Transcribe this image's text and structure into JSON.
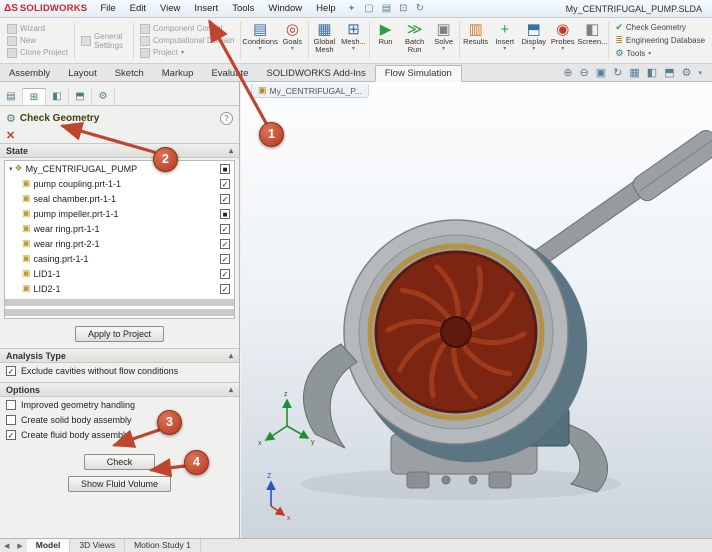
{
  "titlebar": {
    "logo_text": "SOLIDWORKS",
    "menus": [
      "File",
      "Edit",
      "View",
      "Insert",
      "Tools",
      "Window",
      "Help"
    ],
    "app_title": "My_CENTRIFUGAL_PUMP.SLDA"
  },
  "ribbon": {
    "project_stack": [
      "Wizard",
      "New",
      "Clone Project"
    ],
    "general_settings": "General Settings",
    "control_stack": [
      "Component Control",
      "Computational Domain",
      "Project"
    ],
    "buttons": [
      {
        "label": "Conditions",
        "icon": "▤"
      },
      {
        "label": "Goals",
        "icon": "◎"
      },
      {
        "label": "Global Mesh",
        "icon": "▦"
      },
      {
        "label": "Mesh...",
        "icon": "⊞"
      },
      {
        "label": "Run",
        "icon": "▶"
      },
      {
        "label": "Batch Run",
        "icon": "≫"
      },
      {
        "label": "Solve",
        "icon": "▣"
      },
      {
        "label": "Results",
        "icon": "▥"
      },
      {
        "label": "Insert",
        "icon": "+"
      },
      {
        "label": "Display",
        "icon": "⬒"
      },
      {
        "label": "Probes",
        "icon": "◉"
      },
      {
        "label": "Screen...",
        "icon": "◧"
      }
    ],
    "tools_stack": [
      {
        "label": "Check Geometry",
        "icon": "✔"
      },
      {
        "label": "Engineering Database",
        "icon": "≣"
      },
      {
        "label": "Tools",
        "icon": "⚙"
      }
    ]
  },
  "tabbar": {
    "tabs": [
      "Assembly",
      "Layout",
      "Sketch",
      "Markup",
      "Evaluate",
      "SOLIDWORKS Add-Ins",
      "Flow Simulation"
    ]
  },
  "viewport": {
    "doc_tab": "My_CENTRIFUGAL_P..."
  },
  "panel": {
    "title": "Check Geometry",
    "state_header": "State",
    "tree": [
      {
        "label": "My_CENTRIFUGAL_PUMP",
        "check": "■"
      },
      {
        "label": "pump coupling.prt-1-1",
        "check": "✓"
      },
      {
        "label": "seal chamber.prt-1-1",
        "check": "✓"
      },
      {
        "label": "pump impeller.prt-1-1",
        "check": "■"
      },
      {
        "label": "wear ring.prt-1-1",
        "check": "✓"
      },
      {
        "label": "wear ring.prt-2-1",
        "check": "✓"
      },
      {
        "label": "casing.prt-1-1",
        "check": "✓"
      },
      {
        "label": "LID1-1",
        "check": "✓"
      },
      {
        "label": "LID2-1",
        "check": "✓"
      }
    ],
    "apply_button": "Apply to Project",
    "analysis_header": "Analysis Type",
    "analysis_option": {
      "label": "Exclude cavities without flow conditions",
      "check": "✓"
    },
    "options_header": "Options",
    "options": [
      {
        "label": "Improved geometry handling",
        "check": ""
      },
      {
        "label": "Create solid body assembly",
        "check": ""
      },
      {
        "label": "Create fluid body assembly",
        "check": "✓"
      }
    ],
    "check_button": "Check",
    "show_fluid_button": "Show Fluid Volume"
  },
  "callouts": [
    {
      "number": "1"
    },
    {
      "number": "2"
    },
    {
      "number": "3"
    },
    {
      "number": "4"
    }
  ],
  "bottombar": {
    "tabs": [
      "Model",
      "3D Views",
      "Motion Study 1"
    ]
  },
  "colors": {
    "callout": "#bf452e",
    "impeller": "#7c2513",
    "casing_teal": "#55707c",
    "logo_red": "#d2232a"
  }
}
